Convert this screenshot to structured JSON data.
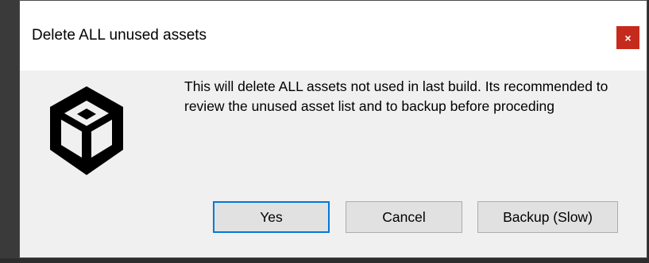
{
  "window": {
    "title": "Delete ALL unused assets",
    "close_label": "×"
  },
  "dialog": {
    "message": "This will delete ALL assets not used in last build. Its recommended to review the unused asset list and to backup before proceding",
    "icon": "unity-logo-icon"
  },
  "buttons": {
    "yes_label": "Yes",
    "cancel_label": "Cancel",
    "backup_label": "Backup (Slow)"
  },
  "colors": {
    "close_button": "#c42b1c",
    "default_button_border": "#0078d7",
    "dialog_background": "#f0f0f0",
    "titlebar_background": "#ffffff"
  }
}
